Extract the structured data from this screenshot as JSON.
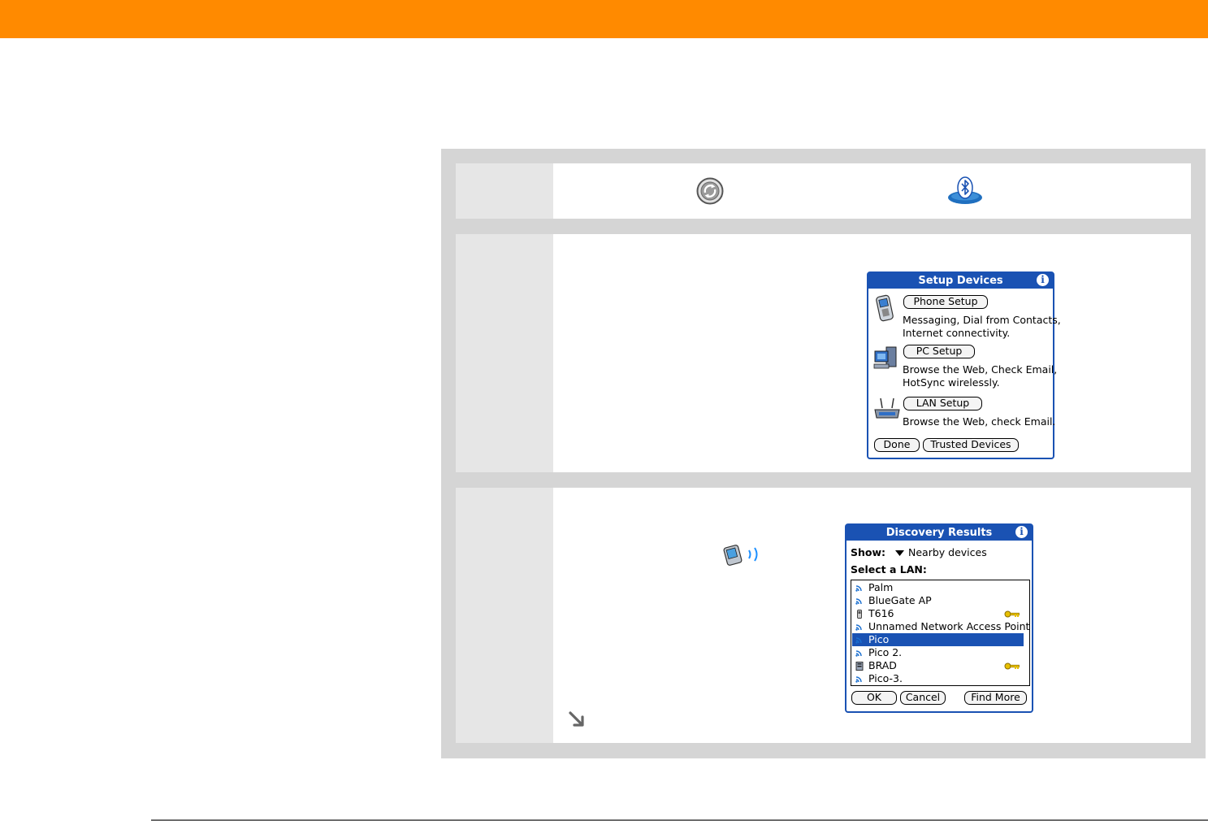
{
  "setup_devices_dialog": {
    "title": "Setup Devices",
    "info": "i",
    "phone_setup_button": "Phone Setup",
    "phone_desc_line1": "Messaging, Dial from Contacts,",
    "phone_desc_line2": "Internet connectivity.",
    "pc_setup_button": "PC Setup",
    "pc_desc_line1": "Browse the Web, Check Email,",
    "pc_desc_line2": "HotSync wirelessly.",
    "lan_setup_button": "LAN Setup",
    "lan_desc_line1": "Browse the Web, check Email.",
    "done_button": "Done",
    "trusted_devices_button": "Trusted Devices"
  },
  "discovery_dialog": {
    "title": "Discovery Results",
    "info": "i",
    "show_label": "Show:",
    "show_value": "Nearby devices",
    "select_label": "Select a LAN:",
    "items": [
      {
        "name": "Palm",
        "icon": "access-point-icon",
        "locked": false,
        "selected": false
      },
      {
        "name": "BlueGate AP",
        "icon": "access-point-icon",
        "locked": false,
        "selected": false
      },
      {
        "name": "T616",
        "icon": "phone-device-icon",
        "locked": true,
        "selected": false
      },
      {
        "name": "Unnamed Network Access Point",
        "icon": "access-point-icon",
        "locked": false,
        "selected": false
      },
      {
        "name": "Pico",
        "icon": "access-point-icon",
        "locked": false,
        "selected": true
      },
      {
        "name": "Pico 2.",
        "icon": "access-point-icon",
        "locked": false,
        "selected": false
      },
      {
        "name": "BRAD",
        "icon": "computer-device-icon",
        "locked": true,
        "selected": false
      },
      {
        "name": "Pico-3.",
        "icon": "access-point-icon",
        "locked": false,
        "selected": false
      }
    ],
    "ok_button": "OK",
    "cancel_button": "Cancel",
    "find_more_button": "Find More"
  },
  "colors": {
    "accent_bar": "#ff8a00",
    "palm_blue": "#1a52b3",
    "key_gold": "#e8c000"
  }
}
